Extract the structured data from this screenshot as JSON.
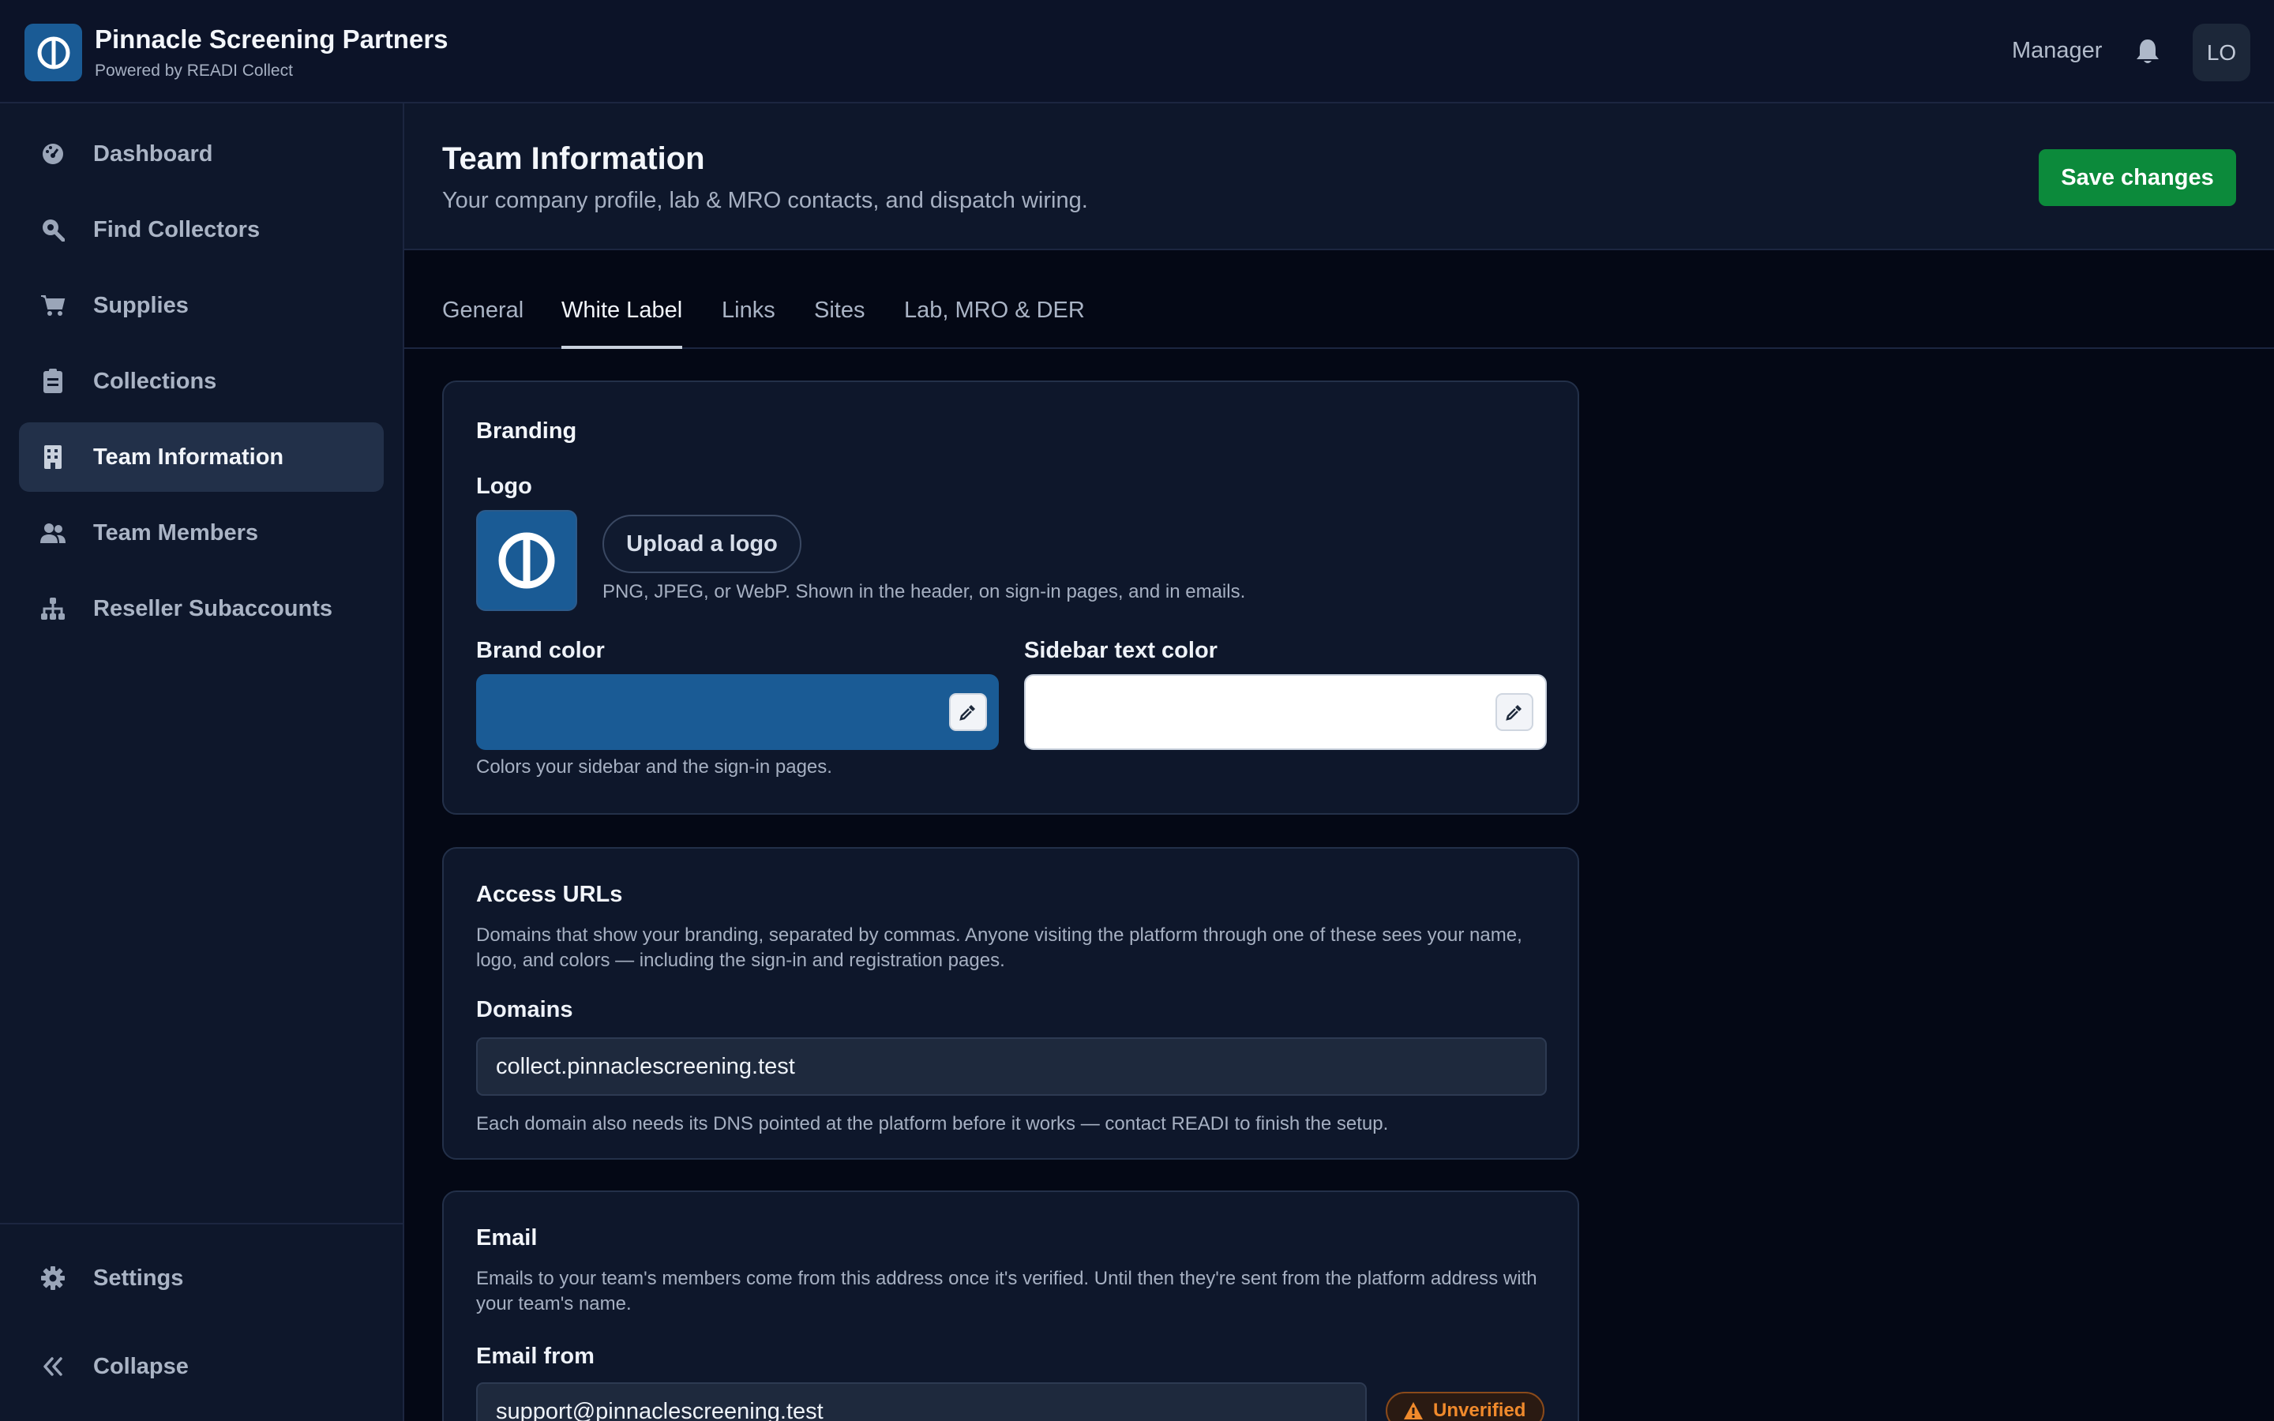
{
  "header": {
    "brand_title": "Pinnacle Screening Partners",
    "brand_subtitle": "Powered by READI Collect",
    "role": "Manager",
    "avatar_initials": "LO"
  },
  "sidebar": {
    "items": [
      {
        "label": "Dashboard",
        "icon": "dashboard-icon"
      },
      {
        "label": "Find Collectors",
        "icon": "search-icon"
      },
      {
        "label": "Supplies",
        "icon": "cart-icon"
      },
      {
        "label": "Collections",
        "icon": "clipboard-icon"
      },
      {
        "label": "Team Information",
        "icon": "building-icon",
        "active": true
      },
      {
        "label": "Team Members",
        "icon": "users-icon"
      },
      {
        "label": "Reseller Subaccounts",
        "icon": "hierarchy-icon"
      }
    ],
    "settings_label": "Settings",
    "collapse_label": "Collapse"
  },
  "page": {
    "title": "Team Information",
    "subtitle": "Your company profile, lab & MRO contacts, and dispatch wiring.",
    "save_label": "Save changes"
  },
  "tabs": [
    {
      "label": "General"
    },
    {
      "label": "White Label",
      "active": true
    },
    {
      "label": "Links"
    },
    {
      "label": "Sites"
    },
    {
      "label": "Lab, MRO & DER"
    }
  ],
  "branding": {
    "title": "Branding",
    "logo_label": "Logo",
    "upload_label": "Upload a logo",
    "upload_help": "PNG, JPEG, or WebP. Shown in the header, on sign-in pages, and in emails.",
    "brand_color_label": "Brand color",
    "brand_color_value": "#1a5b95",
    "sidebar_text_color_label": "Sidebar text color",
    "sidebar_text_color_value": "#ffffff",
    "color_help": "Colors your sidebar and the sign-in pages."
  },
  "access": {
    "title": "Access URLs",
    "description": "Domains that show your branding, separated by commas. Anyone visiting the platform through one of these sees your name, logo, and colors — including the sign-in and registration pages.",
    "domains_label": "Domains",
    "domains_value": "collect.pinnaclescreening.test",
    "domains_help": "Each domain also needs its DNS pointed at the platform before it works — contact READI to finish the setup."
  },
  "email": {
    "title": "Email",
    "description": "Emails to your team's members come from this address once it's verified. Until then they're sent from the platform address with your team's name.",
    "from_label": "Email from",
    "from_value": "support@pinnaclescreening.test",
    "status": "Unverified"
  },
  "colors": {
    "accent_green": "#0c8a3b",
    "brand_blue": "#1a5b95",
    "warning_orange": "#f08a2c"
  }
}
